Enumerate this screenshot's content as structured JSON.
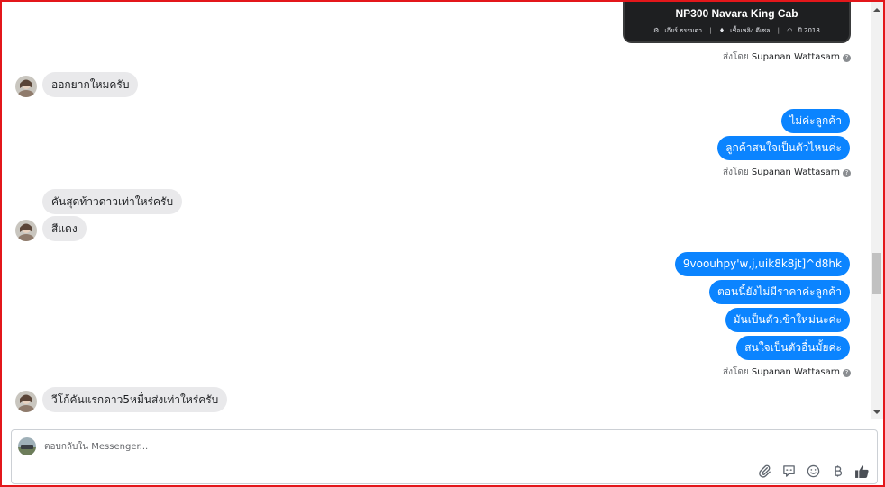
{
  "listing_card": {
    "title": "NP300 Navara King Cab",
    "gear": "เกียร์ ธรรมดา",
    "fuel": "เชื้อเพลิง ดีเซล",
    "year": "ปี 2018",
    "separator": "|"
  },
  "sent_by": {
    "prefix": "ส่งโดย",
    "name": "Supanan Wattasarn",
    "help": "?"
  },
  "messages": {
    "in1": "ออกยากใหมครับ",
    "out1": "ไม่ค่ะลูกค้า",
    "out2": "ลูกค้าสนใจเป็นตัวไหนค่ะ",
    "in2": "คันสุดท้าวดาวเท่าใหร่ครับ",
    "in3": "สีแดง",
    "out3": "9voouhpy'w,j,uik8k8jt]^d8hk",
    "out4": "ตอนนี้ยังไม่มีราคาค่ะลูกค้า",
    "out5": "มันเป็นตัวเข้าใหม่นะค่ะ",
    "out6": "สนใจเป็นตัวอื่นมั้ยค่ะ",
    "in4": "วีโก้คันแรกดาว5หมื่นส่งเท่าใหร่ครับ"
  },
  "composer": {
    "placeholder": "ตอบกลับใน Messenger...",
    "tools": [
      "attach-icon",
      "sticker-icon",
      "emoji-icon",
      "baht-icon",
      "like-icon"
    ]
  },
  "colors": {
    "outgoing_bubble": "#0b84ff",
    "incoming_bubble": "#e9e9eb",
    "frame": "#e3171b",
    "card_bg": "#1e1f21"
  }
}
